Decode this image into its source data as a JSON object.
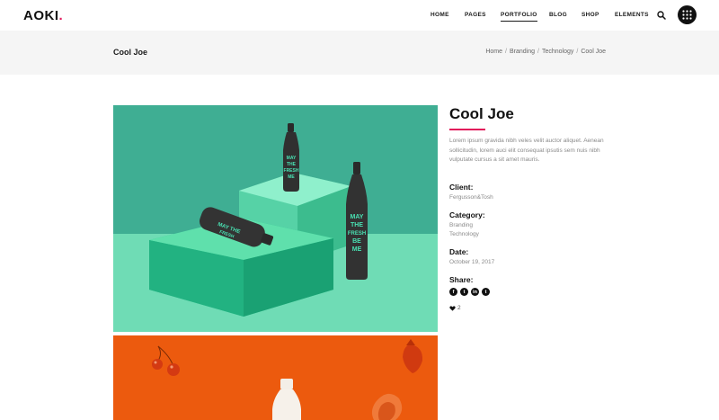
{
  "header": {
    "logo": "AOKI",
    "logo_dot": ".",
    "nav": [
      {
        "label": "HOME"
      },
      {
        "label": "PAGES"
      },
      {
        "label": "PORTFOLIO"
      },
      {
        "label": "BLOG"
      },
      {
        "label": "SHOP"
      },
      {
        "label": "ELEMENTS"
      }
    ],
    "active_nav": "PORTFOLIO"
  },
  "title_bar": {
    "title": "Cool Joe",
    "breadcrumb": [
      "Home",
      "Branding",
      "Technology",
      "Cool Joe"
    ]
  },
  "project": {
    "title": "Cool Joe",
    "description": "Lorem ipsum gravida nibh veles velit auctor aliquet. Aenean sollicitudin, lorem auci elit consequat ipsutis sem nuis nibh vulputate cursus a sit amet mauris.",
    "client_label": "Client:",
    "client": "Fergusson&Tosh",
    "category_label": "Category:",
    "categories": [
      "Branding",
      "Technology"
    ],
    "date_label": "Date:",
    "date": "October 19, 2017",
    "share_label": "Share:",
    "share_icons": [
      "f",
      "t",
      "in",
      "t"
    ],
    "likes": "2"
  },
  "colors": {
    "accent": "#e2175b",
    "teal_bg": "#3aaf94",
    "orange_bg": "#ec5a0e"
  }
}
